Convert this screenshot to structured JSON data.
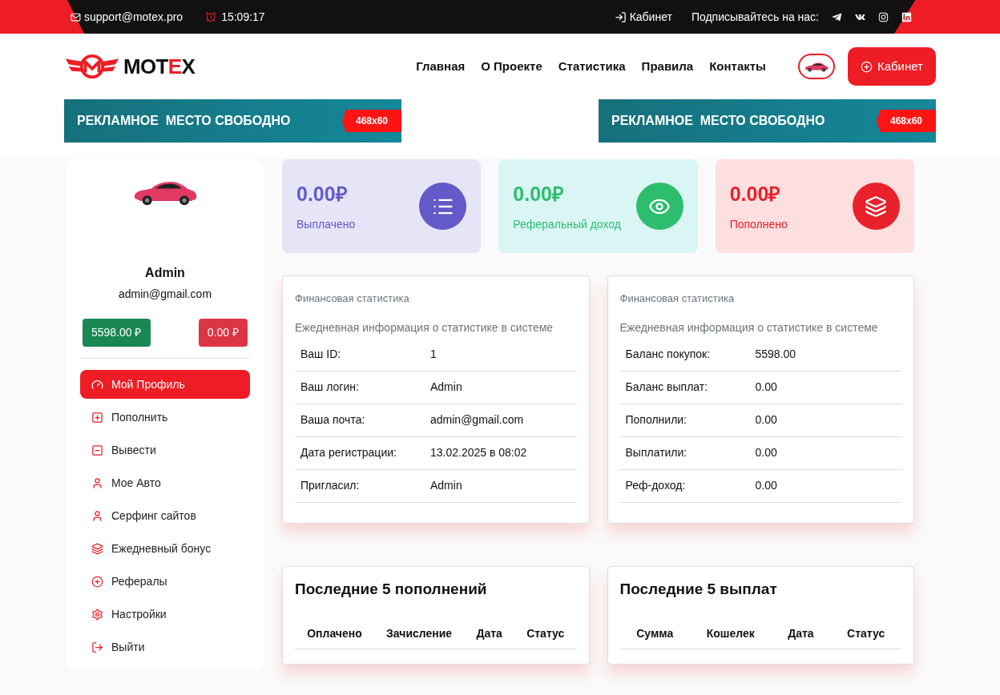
{
  "topbar": {
    "email": "support@motex.pro",
    "time": "15:09:17",
    "cabinet_link": "Кабинет",
    "subscribe_label": "Подписывайтесь на нас:"
  },
  "header": {
    "logo": [
      {
        "text": "MOT",
        "accent": false
      },
      {
        "text": "E",
        "accent": true
      },
      {
        "text": "X",
        "accent": false
      }
    ],
    "nav": [
      "Главная",
      "О Проекте",
      "Статистика",
      "Правила",
      "Контакты"
    ],
    "cabinet_button": "Кабинет"
  },
  "ads": [
    {
      "text": "РЕКЛАМНОЕ  МЕСТО СВОБОДНО",
      "size": "468x60"
    },
    {
      "text": "РЕКЛАМНОЕ  МЕСТО СВОБОДНО",
      "size": "468x60"
    }
  ],
  "profile": {
    "name": "Admin",
    "email": "admin@gmail.com",
    "balances": [
      {
        "value": "5598.00 ₽",
        "kind": "positive"
      },
      {
        "value": "0.00 ₽",
        "kind": "negative"
      }
    ]
  },
  "sidebar": {
    "items": [
      {
        "label": "Мой Профиль",
        "selected": true
      },
      {
        "label": "Пополнить",
        "selected": false
      },
      {
        "label": "Вывести",
        "selected": false
      },
      {
        "label": "Мое Авто",
        "selected": false
      },
      {
        "label": "Серфинг сайтов",
        "selected": false
      },
      {
        "label": "Ежедневный бонус",
        "selected": false
      },
      {
        "label": "Рефералы",
        "selected": false
      },
      {
        "label": "Настройки",
        "selected": false
      },
      {
        "label": "Выйти",
        "selected": false
      }
    ]
  },
  "stats": [
    {
      "value": "0.00₽",
      "label": "Выплачено",
      "kind": "paid"
    },
    {
      "value": "0.00₽",
      "label": "Реферальный доход",
      "kind": "referral"
    },
    {
      "value": "0.00₽",
      "label": "Пополнено",
      "kind": "deposit"
    }
  ],
  "finance": [
    {
      "title": "Финансовая статистика",
      "subtitle": "Ежедневная информация о статистике в системе",
      "rows": [
        {
          "label": "Ваш ID:",
          "value": "1"
        },
        {
          "label": "Ваш логин:",
          "value": "Admin"
        },
        {
          "label": "Ваша почта:",
          "value": "admin@gmail.com"
        },
        {
          "label": "Дата регистрации:",
          "value": "13.02.2025 в 08:02"
        },
        {
          "label": "Пригласил:",
          "value": "Admin"
        }
      ]
    },
    {
      "title": "Финансовая статистика",
      "subtitle": "Ежедневная информация о статистике в системе",
      "rows": [
        {
          "label": "Баланс покупок:",
          "value": "5598.00"
        },
        {
          "label": "Баланс выплат:",
          "value": "0.00"
        },
        {
          "label": "Пополнили:",
          "value": "0.00"
        },
        {
          "label": "Выплатили:",
          "value": "0.00"
        },
        {
          "label": "Реф-доход:",
          "value": "0.00"
        }
      ]
    }
  ],
  "recent": [
    {
      "title": "Последние 5 пополнений",
      "columns": [
        "Оплачено",
        "Зачисление",
        "Дата",
        "Статус"
      ]
    },
    {
      "title": "Последние 5 выплат",
      "columns": [
        "Сумма",
        "Кошелек",
        "Дата",
        "Статус"
      ]
    }
  ]
}
